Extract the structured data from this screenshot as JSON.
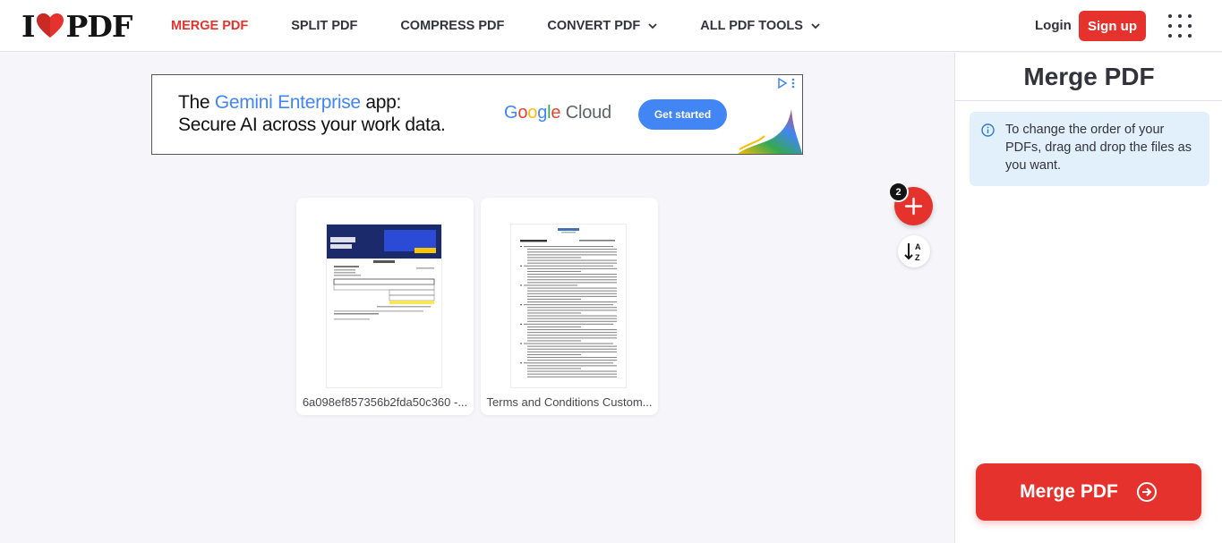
{
  "header": {
    "logo_text_left": "I",
    "logo_text_right": "PDF",
    "nav": [
      {
        "label": "MERGE PDF",
        "active": true,
        "dropdown": false
      },
      {
        "label": "SPLIT PDF",
        "active": false,
        "dropdown": false
      },
      {
        "label": "COMPRESS PDF",
        "active": false,
        "dropdown": false
      },
      {
        "label": "CONVERT PDF",
        "active": false,
        "dropdown": true
      },
      {
        "label": "ALL PDF TOOLS",
        "active": false,
        "dropdown": true
      }
    ],
    "login_label": "Login",
    "signup_label": "Sign up",
    "apps_icon": "grid-dots-icon"
  },
  "ad": {
    "headline_prefix": "The ",
    "headline_highlight": "Gemini Enterprise",
    "headline_suffix": " app:",
    "headline_line2": "Secure AI across your work data.",
    "brand_letters": [
      "G",
      "o",
      "o",
      "g",
      "l",
      "e"
    ],
    "brand_suffix": " Cloud",
    "cta_label": "Get started"
  },
  "files": [
    {
      "name": "6a098ef857356b2fda50c360 -..."
    },
    {
      "name": "Terms and Conditions Custom..."
    }
  ],
  "toolbar": {
    "file_count": "2",
    "add_icon": "plus-icon",
    "sort_icon": "sort-az-icon"
  },
  "sidebar": {
    "title": "Merge PDF",
    "info_text": "To change the order of your PDFs, drag and drop the files as you want.",
    "merge_button_label": "Merge PDF"
  },
  "colors": {
    "accent": "#e5322d",
    "info_bg": "#e2f0fc",
    "page_bg": "#f5f5fa",
    "ad_blue": "#4285f4"
  }
}
